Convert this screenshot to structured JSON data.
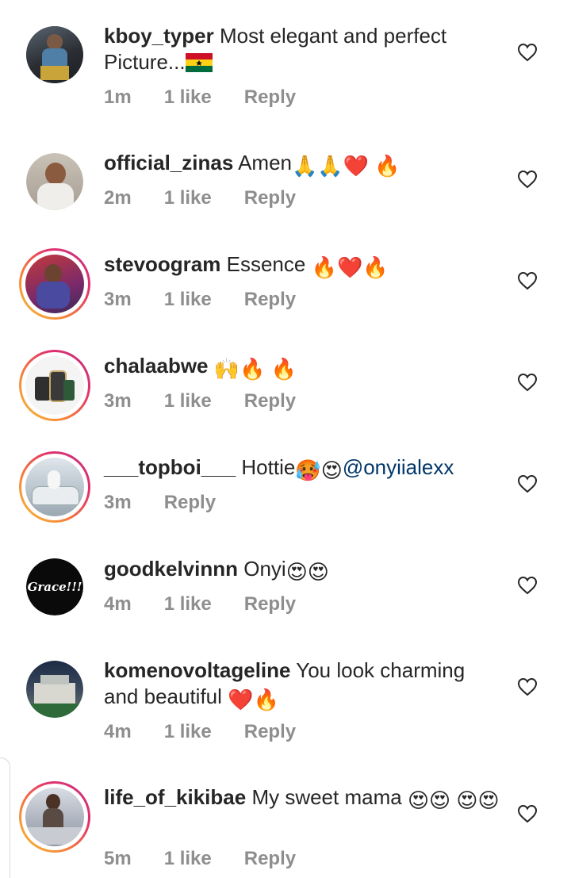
{
  "comments": [
    {
      "username": "kboy_typer",
      "text": "Most elegant and perfect Picture...",
      "time": "1m",
      "likes": "1 like",
      "reply": "Reply"
    },
    {
      "username": "official_zinas",
      "text": "Amen",
      "time": "2m",
      "likes": "1 like",
      "reply": "Reply"
    },
    {
      "username": "stevoogram",
      "text": "Essence ",
      "time": "3m",
      "likes": "1 like",
      "reply": "Reply"
    },
    {
      "username": "chalaabwe",
      "text": "",
      "time": "3m",
      "likes": "1 like",
      "reply": "Reply"
    },
    {
      "username": "___topboi___",
      "text": "Hottie",
      "mention": "@onyiialexx",
      "time": "3m",
      "reply": "Reply"
    },
    {
      "username": "goodkelvinnn",
      "text": "Onyi",
      "time": "4m",
      "likes": "1 like",
      "reply": "Reply",
      "avatar_text": "Grace!!!"
    },
    {
      "username": "komenovoltageline",
      "text": "You look charming and beautiful ",
      "time": "4m",
      "likes": "1 like",
      "reply": "Reply"
    },
    {
      "username": "life_of_kikibae",
      "text": "My sweet mama ",
      "time": "5m",
      "likes": "1 like",
      "reply": "Reply"
    }
  ],
  "icons": {
    "like": "heart-outline-icon",
    "flag": "ghana-flag-icon"
  }
}
